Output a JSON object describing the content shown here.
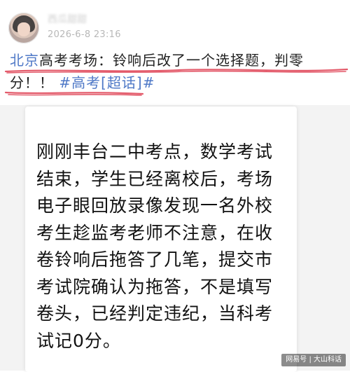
{
  "post": {
    "username": "西瓜甜甜",
    "timestamp": "2026-6-8 23:16",
    "link_text": "北京",
    "text": "高考考场：铃响后改了一个选择题，判零分！！",
    "hashtag": "#高考[超话]#"
  },
  "card": {
    "text": "刚刚丰台二中考点，数学考试结束，学生已经离校后，考场电子眼回放录像发现一名外校考生趁监考老师不注意，在收卷铃响后拖答了几笔，提交市考试院确认为拖答，不是填写卷头，已经判定违纪，当科考试记0分。"
  },
  "watermark": "网易号 | 大山科话",
  "colors": {
    "link": "#4f79c7",
    "underline": "#e35a6a"
  }
}
